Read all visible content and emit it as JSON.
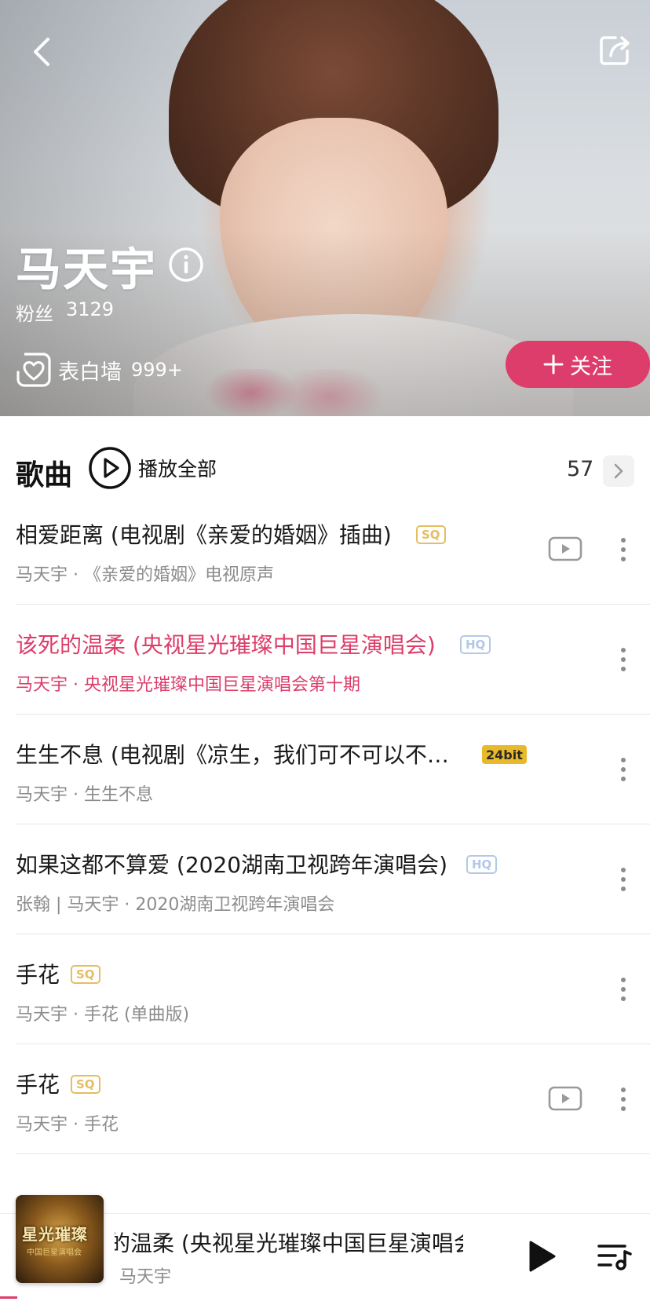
{
  "hero": {
    "artist_name": "马天宇",
    "fans_label": "粉丝",
    "fans_count": "3129",
    "wall_label": "表白墙",
    "wall_count": "999+",
    "follow_label": "关注",
    "icons": {
      "back": "chevron-left-icon",
      "share": "share-icon",
      "info": "info-icon",
      "wall": "heart-wall-icon"
    }
  },
  "songs_section": {
    "title": "歌曲",
    "play_all_label": "播放全部",
    "count": "57"
  },
  "songs": [
    {
      "title": "相爱距离 (电视剧《亲爱的婚姻》插曲)",
      "badge": "SQ",
      "subtitle": "马天宇 · 《亲爱的婚姻》电视原声",
      "has_mv": true,
      "playing": false
    },
    {
      "title": "该死的温柔 (央视星光璀璨中国巨星演唱会)",
      "badge": "HQ",
      "subtitle": "马天宇 · 央视星光璀璨中国巨星演唱会第十期",
      "has_mv": false,
      "playing": true
    },
    {
      "title": "生生不息 (电视剧《凉生，我们可不可以不…",
      "badge": "24bit",
      "subtitle": "马天宇 · 生生不息",
      "has_mv": false,
      "playing": false
    },
    {
      "title": "如果这都不算爱 (2020湖南卫视跨年演唱会)",
      "badge": "HQ",
      "subtitle": "张翰 | 马天宇 · 2020湖南卫视跨年演唱会",
      "has_mv": false,
      "playing": false
    },
    {
      "title": "手花",
      "badge": "SQ",
      "subtitle": "马天宇 · 手花 (单曲版)",
      "has_mv": false,
      "playing": false
    },
    {
      "title": "手花",
      "badge": "SQ",
      "subtitle": "马天宇 · 手花",
      "has_mv": true,
      "playing": false
    }
  ],
  "now_playing": {
    "title": "该死的温柔 (央视星光璀璨中国巨星演唱会)",
    "artist": "马天宇",
    "art_text": "星光璀璨",
    "art_subtext": "中国巨星演唱会",
    "progress": 0.027
  },
  "colors": {
    "accent": "#dc3d6a",
    "sq_badge": "#e6bd61",
    "hq_badge": "#b4c8e6",
    "bit_badge": "#e8b92a"
  }
}
